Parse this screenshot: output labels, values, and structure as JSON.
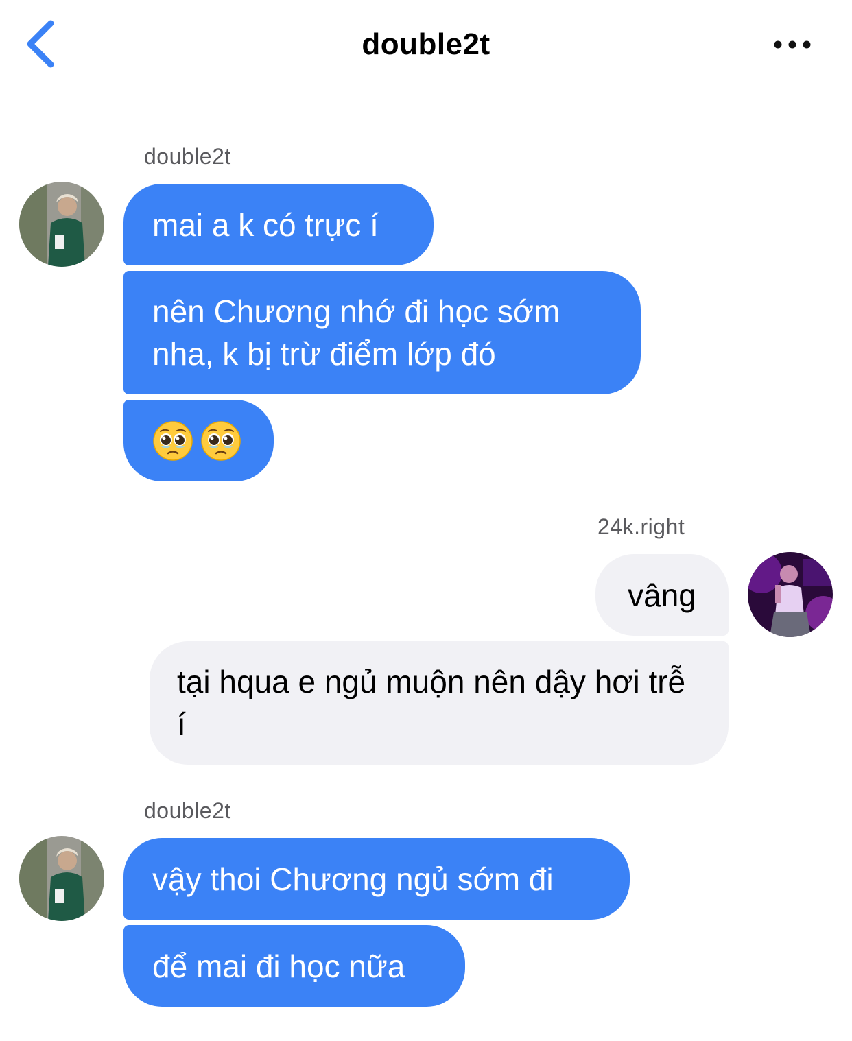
{
  "header": {
    "title": "double2t",
    "back_icon": "chevron-left-icon",
    "more_icon": "more-horizontal-icon",
    "accent": "#3b82f6"
  },
  "messages": [
    {
      "group": "incoming",
      "sender": "double2t",
      "bubbles": [
        {
          "text": "mai a k có trực í"
        },
        {
          "text": "nên Chương nhớ đi học sớm nha, k bị trừ điểm lớp đó"
        },
        {
          "text": "🥹🥹",
          "icon": "pleading-face-emoji"
        }
      ]
    },
    {
      "group": "outgoing",
      "sender": "24k.right",
      "bubbles": [
        {
          "text": "vâng"
        },
        {
          "text": "tại hqua e ngủ muộn nên dậy hơi trễ í"
        }
      ]
    },
    {
      "group": "incoming",
      "sender": "double2t",
      "bubbles": [
        {
          "text": "vậy thoi Chương ngủ sớm đi"
        },
        {
          "text": "để mai đi học nữa"
        }
      ]
    }
  ],
  "colors": {
    "incoming_bubble": "#3b82f6",
    "outgoing_bubble": "#f1f1f5",
    "sender_label": "#5a5a5e"
  }
}
